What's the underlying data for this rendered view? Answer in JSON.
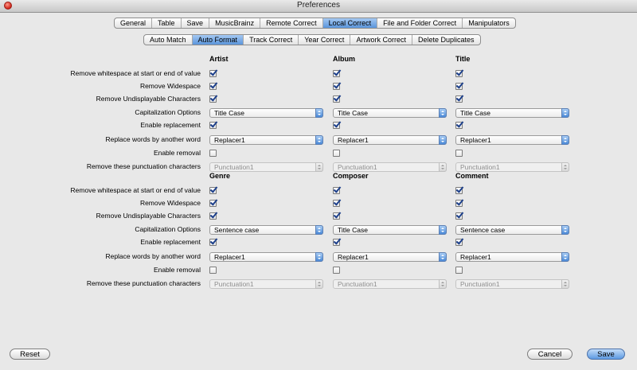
{
  "window": {
    "title": "Preferences"
  },
  "main_tabs": [
    {
      "label": "General",
      "active": false
    },
    {
      "label": "Table",
      "active": false
    },
    {
      "label": "Save",
      "active": false
    },
    {
      "label": "MusicBrainz",
      "active": false
    },
    {
      "label": "Remote Correct",
      "active": false
    },
    {
      "label": "Local Correct",
      "active": true
    },
    {
      "label": "File and Folder Correct",
      "active": false
    },
    {
      "label": "Manipulators",
      "active": false
    }
  ],
  "sub_tabs": [
    {
      "label": "Auto Match",
      "active": false
    },
    {
      "label": "Auto Format",
      "active": true
    },
    {
      "label": "Track Correct",
      "active": false
    },
    {
      "label": "Year Correct",
      "active": false
    },
    {
      "label": "Artwork Correct",
      "active": false
    },
    {
      "label": "Delete Duplicates",
      "active": false
    }
  ],
  "row_labels": [
    "Remove whitespace at start or end of value",
    "Remove Widespace",
    "Remove Undisplayable Characters",
    "Capitalization Options",
    "Enable replacement",
    "Replace words by another word",
    "Enable removal",
    "Remove these punctuation characters"
  ],
  "sections": [
    {
      "columns": [
        {
          "name": "Artist",
          "ws": true,
          "wide": true,
          "undisp": true,
          "cap": "Title Case",
          "repl_enabled": true,
          "replacer": "Replacer1",
          "rem_enabled": false,
          "punct": "Punctuation1"
        },
        {
          "name": "Album",
          "ws": true,
          "wide": true,
          "undisp": true,
          "cap": "Title Case",
          "repl_enabled": true,
          "replacer": "Replacer1",
          "rem_enabled": false,
          "punct": "Punctuation1"
        },
        {
          "name": "Title",
          "ws": true,
          "wide": true,
          "undisp": true,
          "cap": "Title Case",
          "repl_enabled": true,
          "replacer": "Replacer1",
          "rem_enabled": false,
          "punct": "Punctuation1"
        }
      ]
    },
    {
      "columns": [
        {
          "name": "Genre",
          "ws": true,
          "wide": true,
          "undisp": true,
          "cap": "Sentence case",
          "repl_enabled": true,
          "replacer": "Replacer1",
          "rem_enabled": false,
          "punct": "Punctuation1"
        },
        {
          "name": "Composer",
          "ws": true,
          "wide": true,
          "undisp": true,
          "cap": "Title Case",
          "repl_enabled": true,
          "replacer": "Replacer1",
          "rem_enabled": false,
          "punct": "Punctuation1"
        },
        {
          "name": "Comment",
          "ws": true,
          "wide": true,
          "undisp": true,
          "cap": "Sentence case",
          "repl_enabled": true,
          "replacer": "Replacer1",
          "rem_enabled": false,
          "punct": "Punctuation1"
        }
      ]
    }
  ],
  "buttons": {
    "reset": "Reset",
    "cancel": "Cancel",
    "save": "Save"
  }
}
